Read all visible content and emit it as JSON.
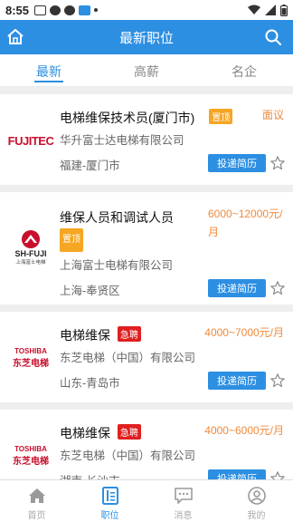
{
  "status_bar": {
    "time": "8:55",
    "left_icons": [
      "mail-icon",
      "chat-icon",
      "chat-icon",
      "app-icon",
      "dot-icon"
    ],
    "right_icons": [
      "wifi-icon",
      "signal-icon",
      "battery-icon"
    ]
  },
  "app_bar": {
    "title": "最新职位",
    "left_icon": "home-icon",
    "right_icon": "search-icon"
  },
  "tabs": [
    {
      "label": "最新",
      "active": true
    },
    {
      "label": "高薪",
      "active": false
    },
    {
      "label": "名企",
      "active": false
    }
  ],
  "jobs": [
    {
      "title": "电梯维保技术员(厦门市)",
      "badge": "置顶",
      "salary": "面议",
      "company": "华升富士达电梯有限公司",
      "location": "福建-厦门市",
      "logo_text": "FUJITEC",
      "apply_label": "投递简历"
    },
    {
      "title": "维保人员和调试人员",
      "badge": "置顶",
      "salary_line1": "6000~12000元/",
      "salary_line2": "月",
      "company": "上海富士电梯有限公司",
      "location": "上海-奉贤区",
      "logo_text": "SH-FUJI",
      "logo_sub": "上海富士电梯",
      "apply_label": "投递简历"
    },
    {
      "title": "电梯维保",
      "badge": "急聘",
      "salary": "4000~7000元/月",
      "company": "东芝电梯（中国）有限公司",
      "location": "山东-青岛市",
      "logo_text": "TOSHIBA",
      "logo_sub": "东芝电梯",
      "apply_label": "投递简历"
    },
    {
      "title": "电梯维保",
      "badge": "急聘",
      "salary": "4000~6000元/月",
      "company": "东芝电梯（中国）有限公司",
      "location": "湖南-长沙市",
      "logo_text": "TOSHIBA",
      "logo_sub": "东芝电梯",
      "apply_label": "投递简历"
    }
  ],
  "bottom_nav": [
    {
      "label": "首页",
      "icon": "home-icon",
      "active": false
    },
    {
      "label": "职位",
      "icon": "document-icon",
      "active": true
    },
    {
      "label": "消息",
      "icon": "message-icon",
      "active": false
    },
    {
      "label": "我的",
      "icon": "user-icon",
      "active": false
    }
  ],
  "colors": {
    "primary": "#2c8fe2",
    "salary": "#f08a3c",
    "badge_gold": "#f5a623",
    "badge_red": "#e02020"
  }
}
